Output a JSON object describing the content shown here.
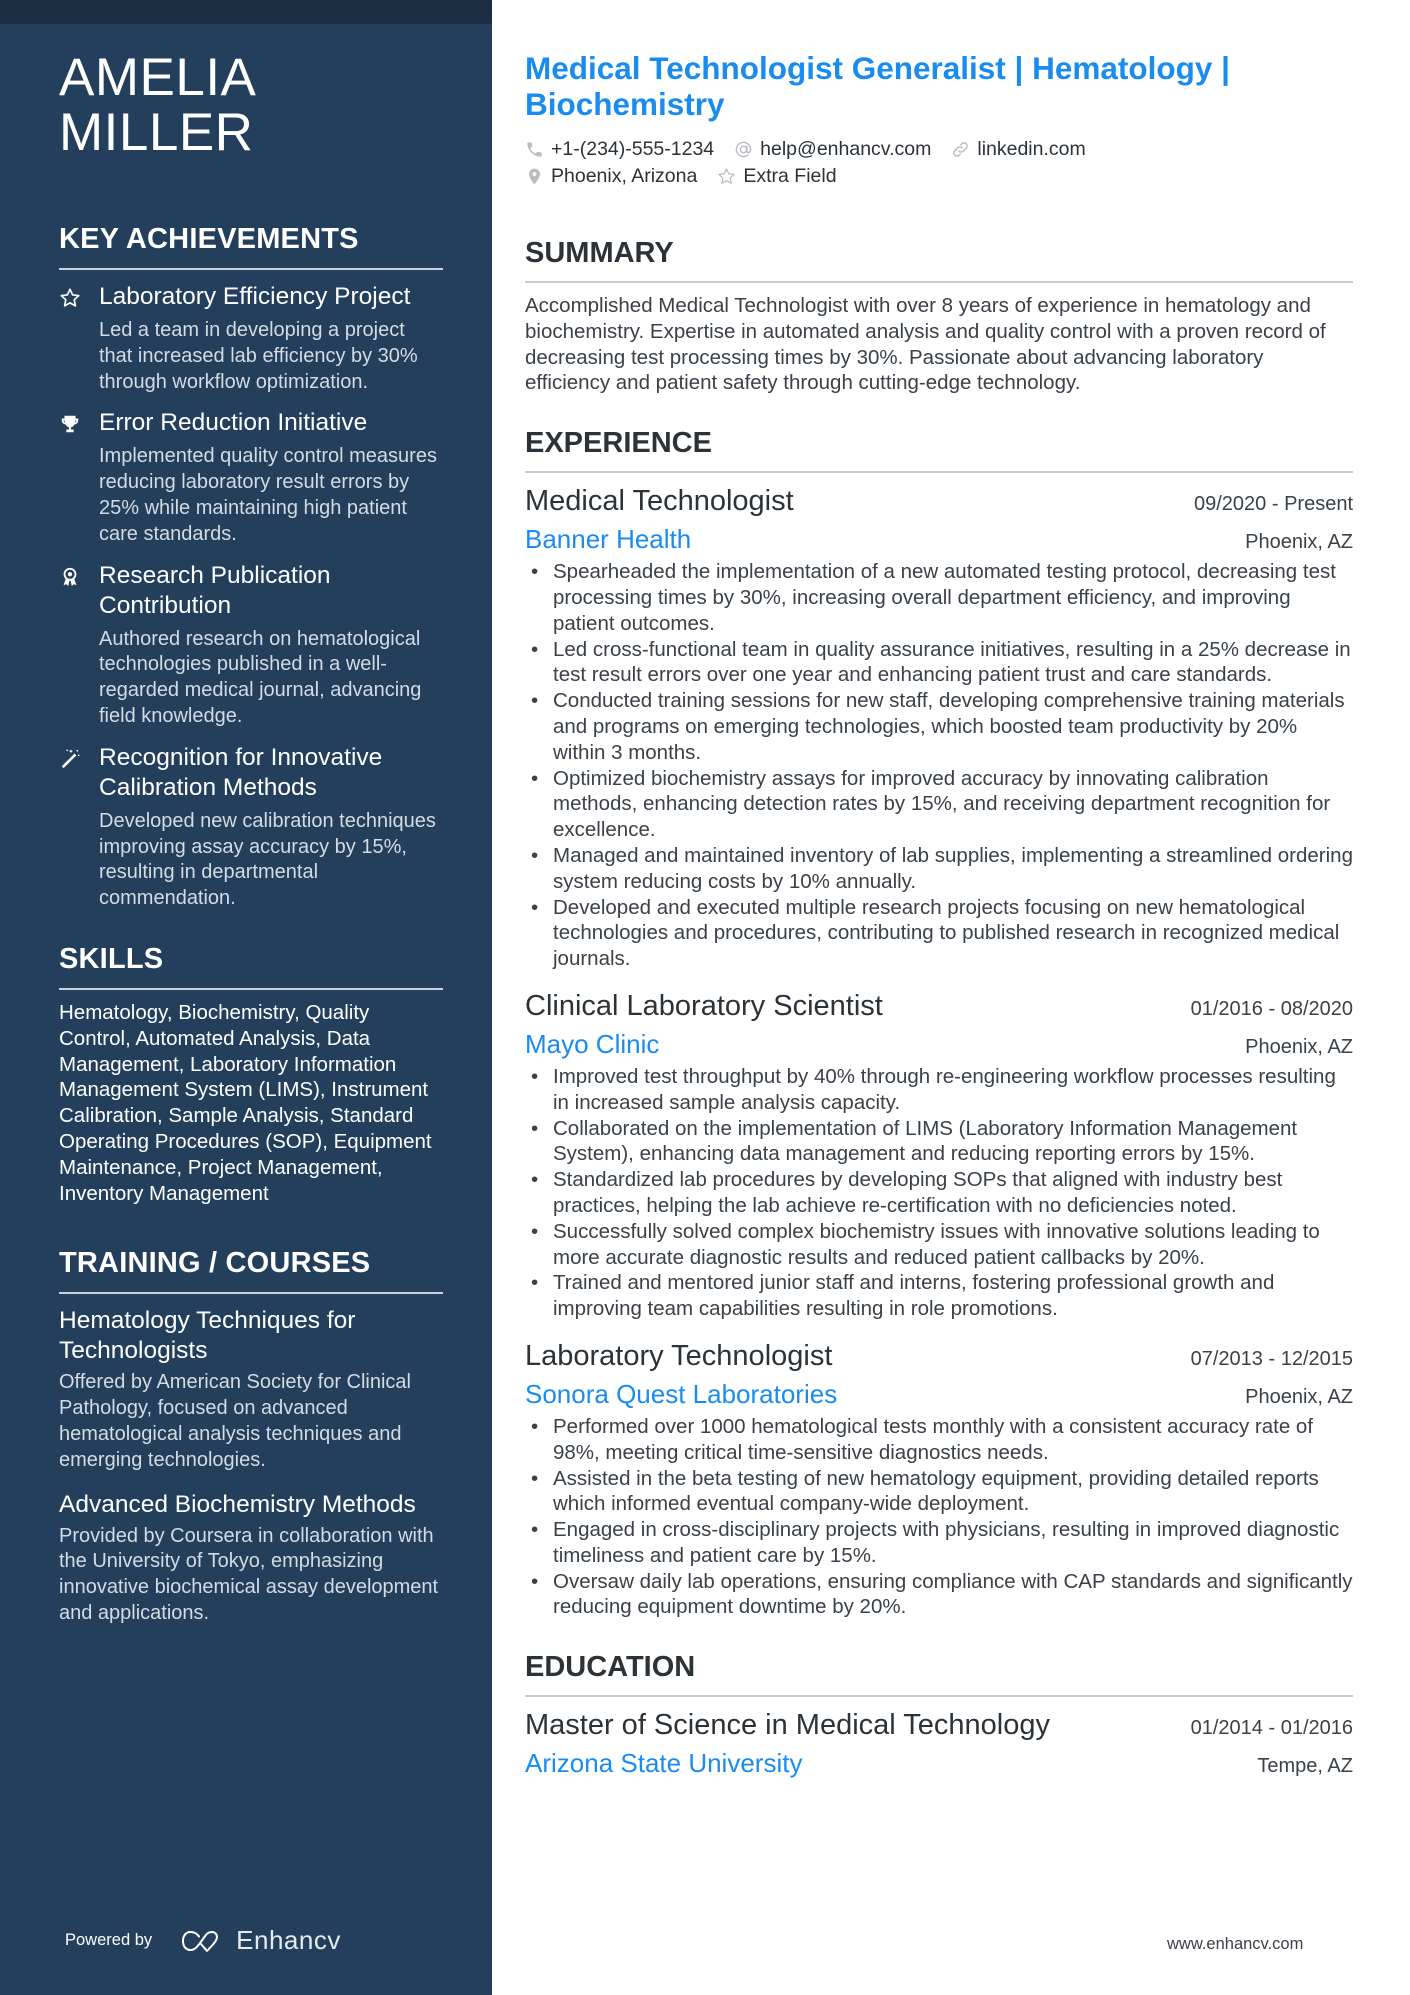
{
  "sidebar": {
    "name_line1": "AMELIA",
    "name_line2": "MILLER",
    "achievements": {
      "title": "KEY ACHIEVEMENTS",
      "items": [
        {
          "icon": "star-icon",
          "title": "Laboratory Efficiency Project",
          "description": "Led a team in developing a project that increased lab efficiency by 30% through workflow optimization."
        },
        {
          "icon": "trophy-icon",
          "title": "Error Reduction Initiative",
          "description": "Implemented quality control measures reducing laboratory result errors by 25% while maintaining high patient care standards."
        },
        {
          "icon": "award-ribbon-icon",
          "title": "Research Publication Contribution",
          "description": "Authored research on hematological technologies published in a well-regarded medical journal, advancing field knowledge."
        },
        {
          "icon": "magic-wand-icon",
          "title": "Recognition for Innovative Calibration Methods",
          "description": "Developed new calibration techniques improving assay accuracy by 15%, resulting in departmental commendation."
        }
      ]
    },
    "skills": {
      "title": "SKILLS",
      "text": "Hematology, Biochemistry, Quality Control, Automated Analysis, Data Management, Laboratory Information Management System (LIMS), Instrument Calibration, Sample Analysis, Standard Operating Procedures (SOP), Equipment Maintenance, Project Management, Inventory Management"
    },
    "training": {
      "title": "TRAINING / COURSES",
      "items": [
        {
          "title": "Hematology Techniques for Technologists",
          "description": "Offered by American Society for Clinical Pathology, focused on advanced hematological analysis techniques and emerging technologies."
        },
        {
          "title": "Advanced Biochemistry Methods",
          "description": "Provided by Coursera in collaboration with the University of Tokyo, emphasizing innovative biochemical assay development and applications."
        }
      ]
    },
    "footer": {
      "powered_by": "Powered by",
      "brand": "Enhancv"
    }
  },
  "header": {
    "headline": "Medical Technologist Generalist | Hematology | Biochemistry",
    "contacts": {
      "phone": "+1-(234)-555-1234",
      "email": "help@enhancv.com",
      "link": "linkedin.com",
      "location": "Phoenix, Arizona",
      "extra": "Extra Field"
    }
  },
  "summary": {
    "title": "SUMMARY",
    "text": "Accomplished Medical Technologist with over 8 years of experience in hematology and biochemistry. Expertise in automated analysis and quality control with a proven record of decreasing test processing times by 30%. Passionate about advancing laboratory efficiency and patient safety through cutting-edge technology."
  },
  "experience": {
    "title": "EXPERIENCE",
    "jobs": [
      {
        "title": "Medical Technologist",
        "dates": "09/2020 - Present",
        "company": "Banner Health",
        "location": "Phoenix, AZ",
        "bullets": [
          "Spearheaded the implementation of a new automated testing protocol, decreasing test processing times by 30%, increasing overall department efficiency, and improving patient outcomes.",
          "Led cross-functional team in quality assurance initiatives, resulting in a 25% decrease in test result errors over one year and enhancing patient trust and care standards.",
          "Conducted training sessions for new staff, developing comprehensive training materials and programs on emerging technologies, which boosted team productivity by 20% within 3 months.",
          "Optimized biochemistry assays for improved accuracy by innovating calibration methods, enhancing detection rates by 15%, and receiving department recognition for excellence.",
          "Managed and maintained inventory of lab supplies, implementing a streamlined ordering system reducing costs by 10% annually.",
          "Developed and executed multiple research projects focusing on new hematological technologies and procedures, contributing to published research in recognized medical journals."
        ]
      },
      {
        "title": "Clinical Laboratory Scientist",
        "dates": "01/2016 - 08/2020",
        "company": "Mayo Clinic",
        "location": "Phoenix, AZ",
        "bullets": [
          "Improved test throughput by 40% through re-engineering workflow processes resulting in increased sample analysis capacity.",
          "Collaborated on the implementation of LIMS (Laboratory Information Management System), enhancing data management and reducing reporting errors by 15%.",
          "Standardized lab procedures by developing SOPs that aligned with industry best practices, helping the lab achieve re-certification with no deficiencies noted.",
          "Successfully solved complex biochemistry issues with innovative solutions leading to more accurate diagnostic results and reduced patient callbacks by 20%.",
          "Trained and mentored junior staff and interns, fostering professional growth and improving team capabilities resulting in role promotions."
        ]
      },
      {
        "title": "Laboratory Technologist",
        "dates": "07/2013 - 12/2015",
        "company": "Sonora Quest Laboratories",
        "location": "Phoenix, AZ",
        "bullets": [
          "Performed over 1000 hematological tests monthly with a consistent accuracy rate of 98%, meeting critical time-sensitive diagnostics needs.",
          "Assisted in the beta testing of new hematology equipment, providing detailed reports which informed eventual company-wide deployment.",
          "Engaged in cross-disciplinary projects with physicians, resulting in improved diagnostic timeliness and patient care by 15%.",
          "Oversaw daily lab operations, ensuring compliance with CAP standards and significantly reducing equipment downtime by 20%."
        ]
      }
    ]
  },
  "education": {
    "title": "EDUCATION",
    "items": [
      {
        "degree": "Master of Science in Medical Technology",
        "dates": "01/2014 - 01/2016",
        "school": "Arizona State University",
        "location": "Tempe, AZ"
      }
    ]
  },
  "footer": {
    "website": "www.enhancv.com"
  },
  "colors": {
    "sidebar_bg": "#233f5c",
    "sidebar_top_band": "#1b2d43",
    "accent": "#1a8cf0",
    "text": "#2b3238"
  }
}
